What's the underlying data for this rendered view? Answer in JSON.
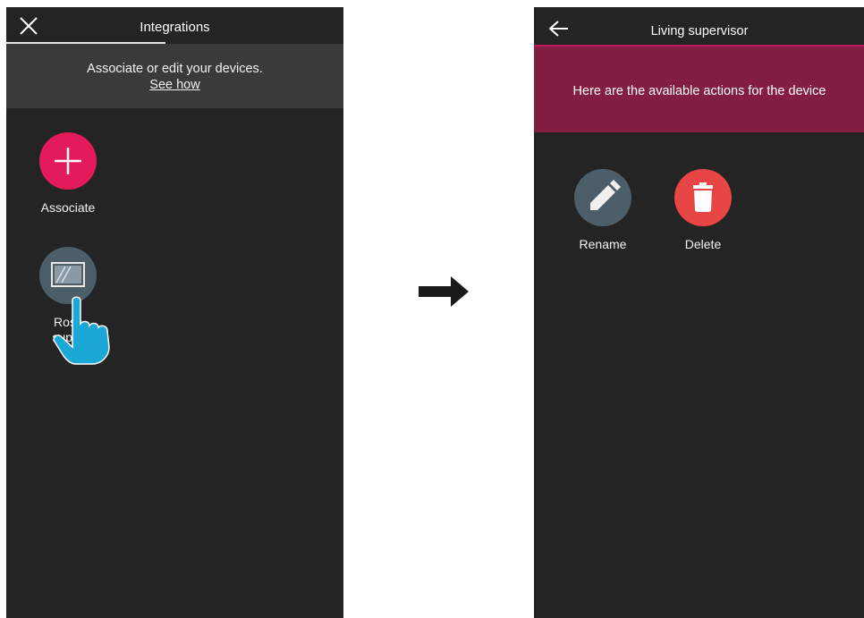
{
  "left_screen": {
    "title": "Integrations",
    "banner": {
      "text": "Associate or edit your devices.",
      "link": "See how"
    },
    "associate": {
      "label": "Associate",
      "icon": "plus-icon",
      "color": "#e41b5a"
    },
    "device": {
      "label_line1": "Ross",
      "label_line2": "super",
      "icon": "tablet-icon",
      "color": "#4c5e6a"
    }
  },
  "right_screen": {
    "title": "Living supervisor",
    "banner_text": "Here are the available actions for the device",
    "banner_color": "#841d42",
    "actions": [
      {
        "label": "Rename",
        "icon": "pencil-icon",
        "color": "#4c5e6a"
      },
      {
        "label": "Delete",
        "icon": "trash-icon",
        "color": "#e84545"
      }
    ]
  }
}
